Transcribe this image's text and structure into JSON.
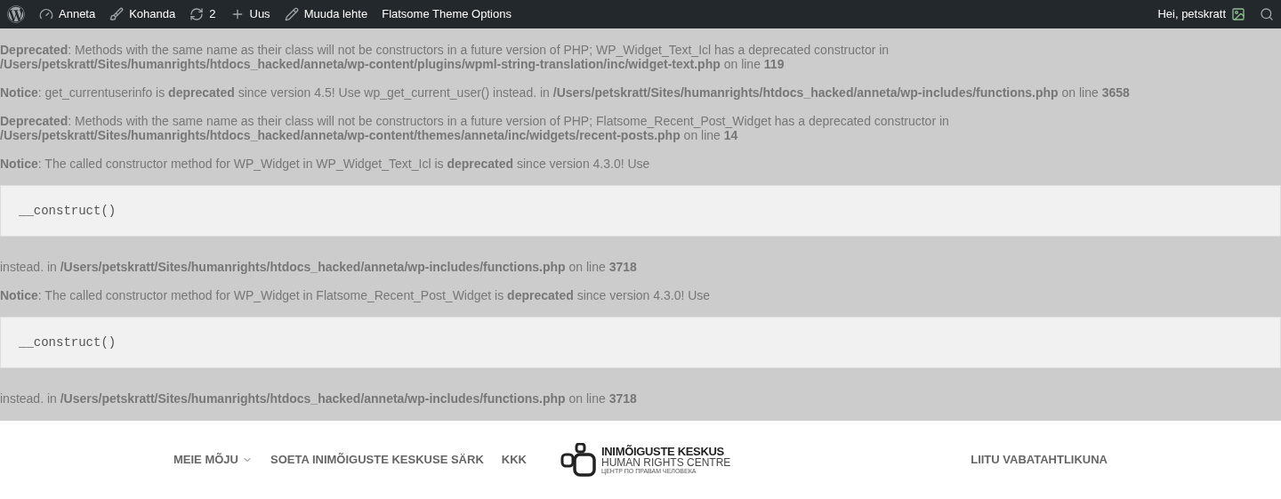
{
  "admin_bar": {
    "items": [
      {
        "kind": "wordpress"
      },
      {
        "kind": "dashboard",
        "label": "Anneta"
      },
      {
        "kind": "brush",
        "label": "Kohanda"
      },
      {
        "kind": "updates",
        "label": "2"
      },
      {
        "kind": "new",
        "label": "Uus"
      },
      {
        "kind": "edit",
        "label": "Muuda lehte"
      },
      {
        "kind": "text",
        "label": "Flatsome Theme Options"
      }
    ],
    "account": "Hei, petskratt"
  },
  "messages": [
    {
      "kind": "text",
      "text": "**Deprecated**: Methods with the same name as their class will not be constructors in a future version of PHP; WP_Widget_Text_Icl has a deprecated constructor in\n**/Users/petskratt/Sites/humanrights/htdocs_hacked/anneta/wp-content/plugins/wpml-string-translation/inc/widget-text.php** on line **119**"
    },
    {
      "kind": "text",
      "text": "**Notice**: get_currentuserinfo is **deprecated** since version 4.5! Use wp_get_current_user() instead. in **/Users/petskratt/Sites/humanrights/htdocs_hacked/anneta/wp-includes/functions.php** on line **3658**"
    },
    {
      "kind": "text",
      "text": "**Deprecated**: Methods with the same name as their class will not be constructors in a future version of PHP; Flatsome_Recent_Post_Widget has a deprecated constructor in\n**/Users/petskratt/Sites/humanrights/htdocs_hacked/anneta/wp-content/themes/anneta/inc/widgets/recent-posts.php** on line **14**"
    },
    {
      "kind": "text",
      "text": "**Notice**: The called constructor method for WP_Widget in WP_Widget_Text_Icl is **deprecated** since version 4.3.0! Use"
    },
    {
      "kind": "code",
      "text": "__construct()"
    },
    {
      "kind": "text",
      "text": "instead. in **/Users/petskratt/Sites/humanrights/htdocs_hacked/anneta/wp-includes/functions.php** on line **3718**"
    },
    {
      "kind": "text",
      "text": "**Notice**: The called constructor method for WP_Widget in Flatsome_Recent_Post_Widget is **deprecated** since version 4.3.0! Use"
    },
    {
      "kind": "code",
      "text": "__construct()"
    },
    {
      "kind": "text",
      "text": "instead. in **/Users/petskratt/Sites/humanrights/htdocs_hacked/anneta/wp-includes/functions.php** on line **3718**"
    }
  ],
  "header": {
    "nav_left": [
      {
        "label": "MEIE MÕJU",
        "dropdown": true
      },
      {
        "label": "SOETA INIMÕIGUSTE KESKUSE SÄRK",
        "dropdown": false
      },
      {
        "label": "KKK",
        "dropdown": false
      }
    ],
    "logo": {
      "title": "INIMÕIGUSTE KESKUS",
      "subtitle": "HUMAN RIGHTS CENTRE",
      "subtitle_ru": "ЦЕНТР ПО ПРАВАМ ЧЕЛОВЕКА"
    },
    "nav_right": [
      {
        "label": "LIITU VABATAHTLIKUNA",
        "dropdown": false
      }
    ]
  }
}
